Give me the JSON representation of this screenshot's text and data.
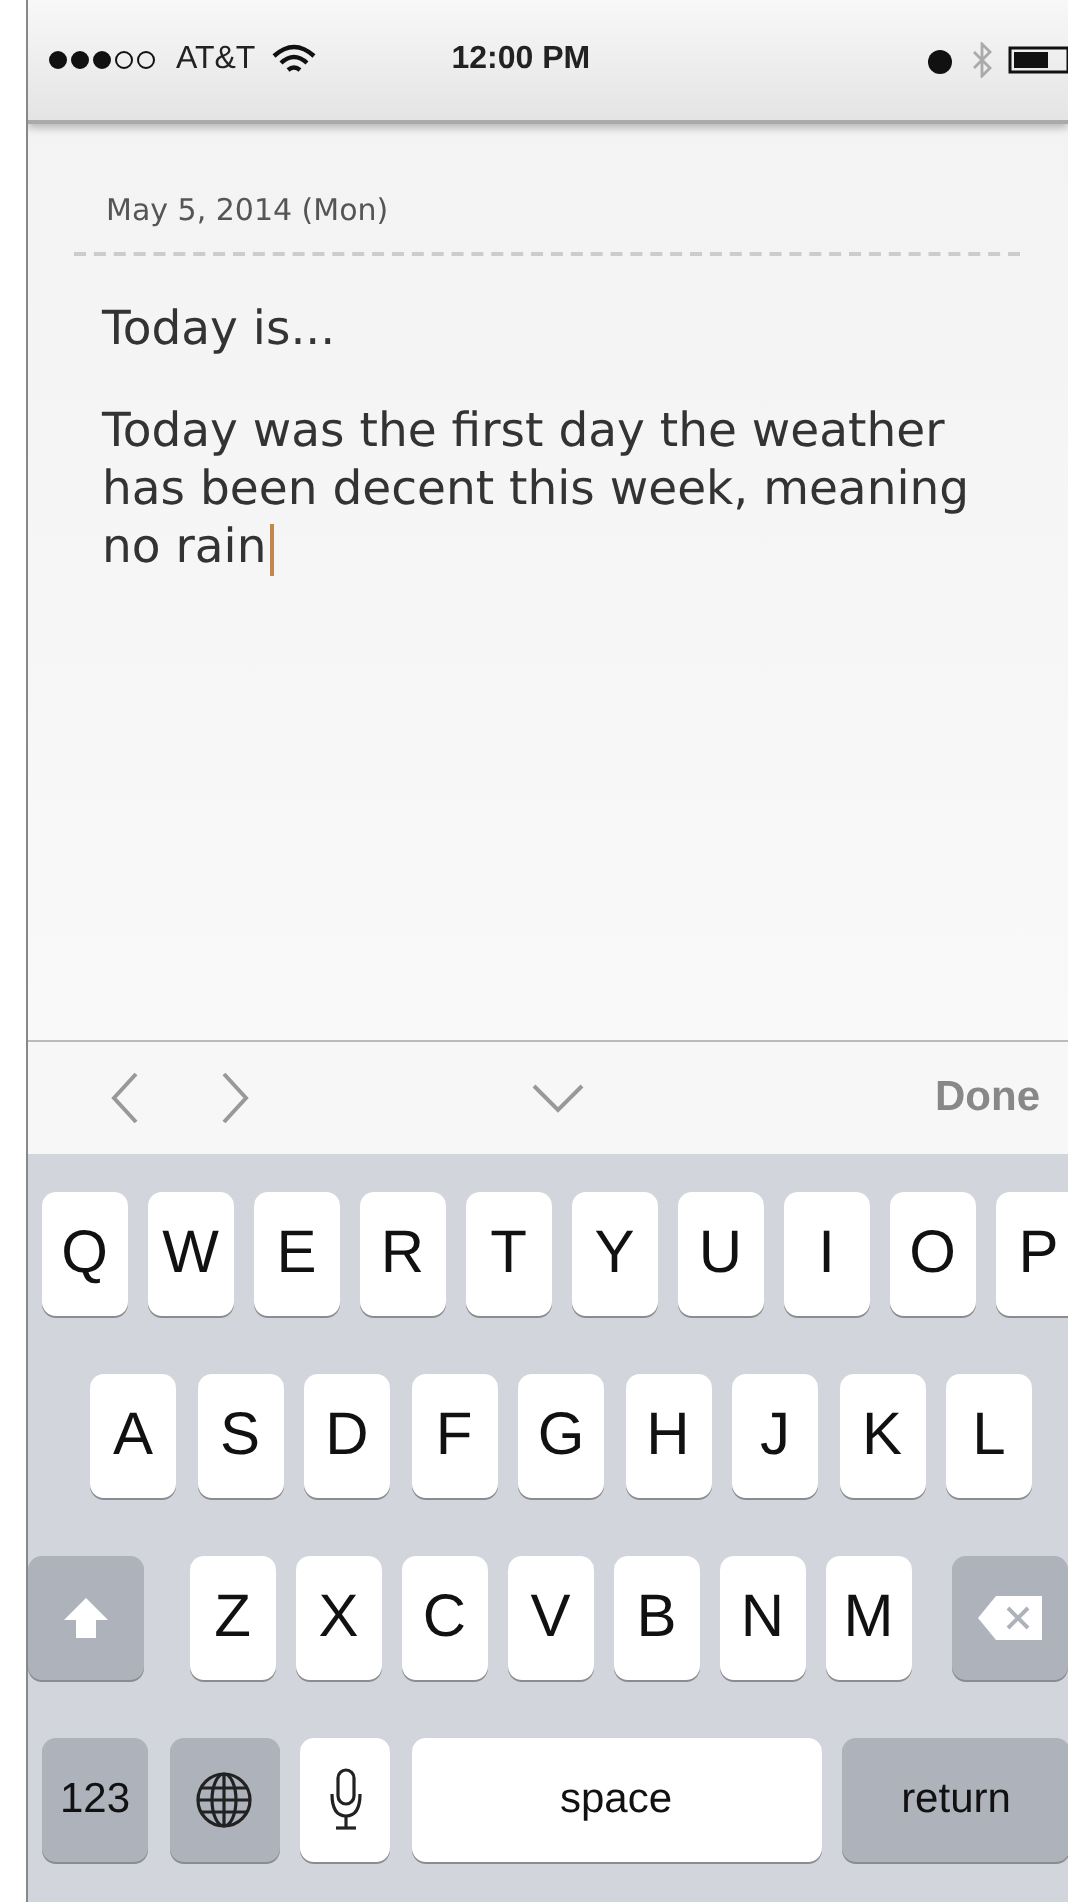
{
  "status_bar": {
    "carrier": "AT&T",
    "time": "12:00 PM"
  },
  "note": {
    "date": "May 5, 2014 (Mon)",
    "title": "Today is...",
    "body": "Today was the first day the weather has been decent this week, meaning no rain",
    "editing": true
  },
  "toolbar": {
    "done": "Done"
  },
  "keyboard": {
    "rows": [
      [
        "Q",
        "W",
        "E",
        "R",
        "T",
        "Y",
        "U",
        "I",
        "O",
        "P"
      ],
      [
        "A",
        "S",
        "D",
        "F",
        "G",
        "H",
        "J",
        "K",
        "L"
      ],
      [
        "Z",
        "X",
        "C",
        "V",
        "B",
        "N",
        "M"
      ]
    ],
    "bottom": [
      {
        "kind": "numbers",
        "label": "123"
      },
      {
        "kind": "globe"
      },
      {
        "kind": "mic"
      },
      {
        "kind": "space",
        "label": "space"
      },
      {
        "kind": "return",
        "label": "return"
      }
    ]
  }
}
